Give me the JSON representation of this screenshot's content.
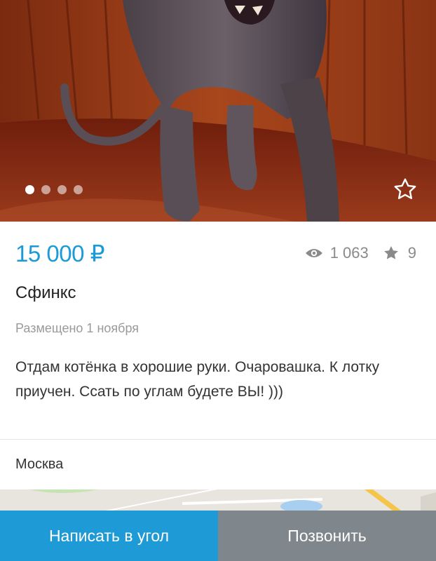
{
  "gallery": {
    "image_description": "hairless sphynx cat",
    "slide_count": 4,
    "active_slide": 1
  },
  "listing": {
    "price": "15 000 ₽",
    "views": "1 063",
    "favorites": "9",
    "title": "Сфинкс",
    "posted": "Размещено 1 ноября",
    "description": "Отдам котёнка в хорошие руки. Очаровашка. К лотку приучен. Ссать по углам будете ВЫ! )))",
    "location": "Москва"
  },
  "actions": {
    "write_label": "Написать в угол",
    "call_label": "Позвонить"
  },
  "colors": {
    "accent": "#1e9ad6",
    "price": "#1a9ad6",
    "call_button": "#7f868c"
  },
  "icons": [
    "eye-icon",
    "star-icon",
    "favorite-star-icon"
  ]
}
